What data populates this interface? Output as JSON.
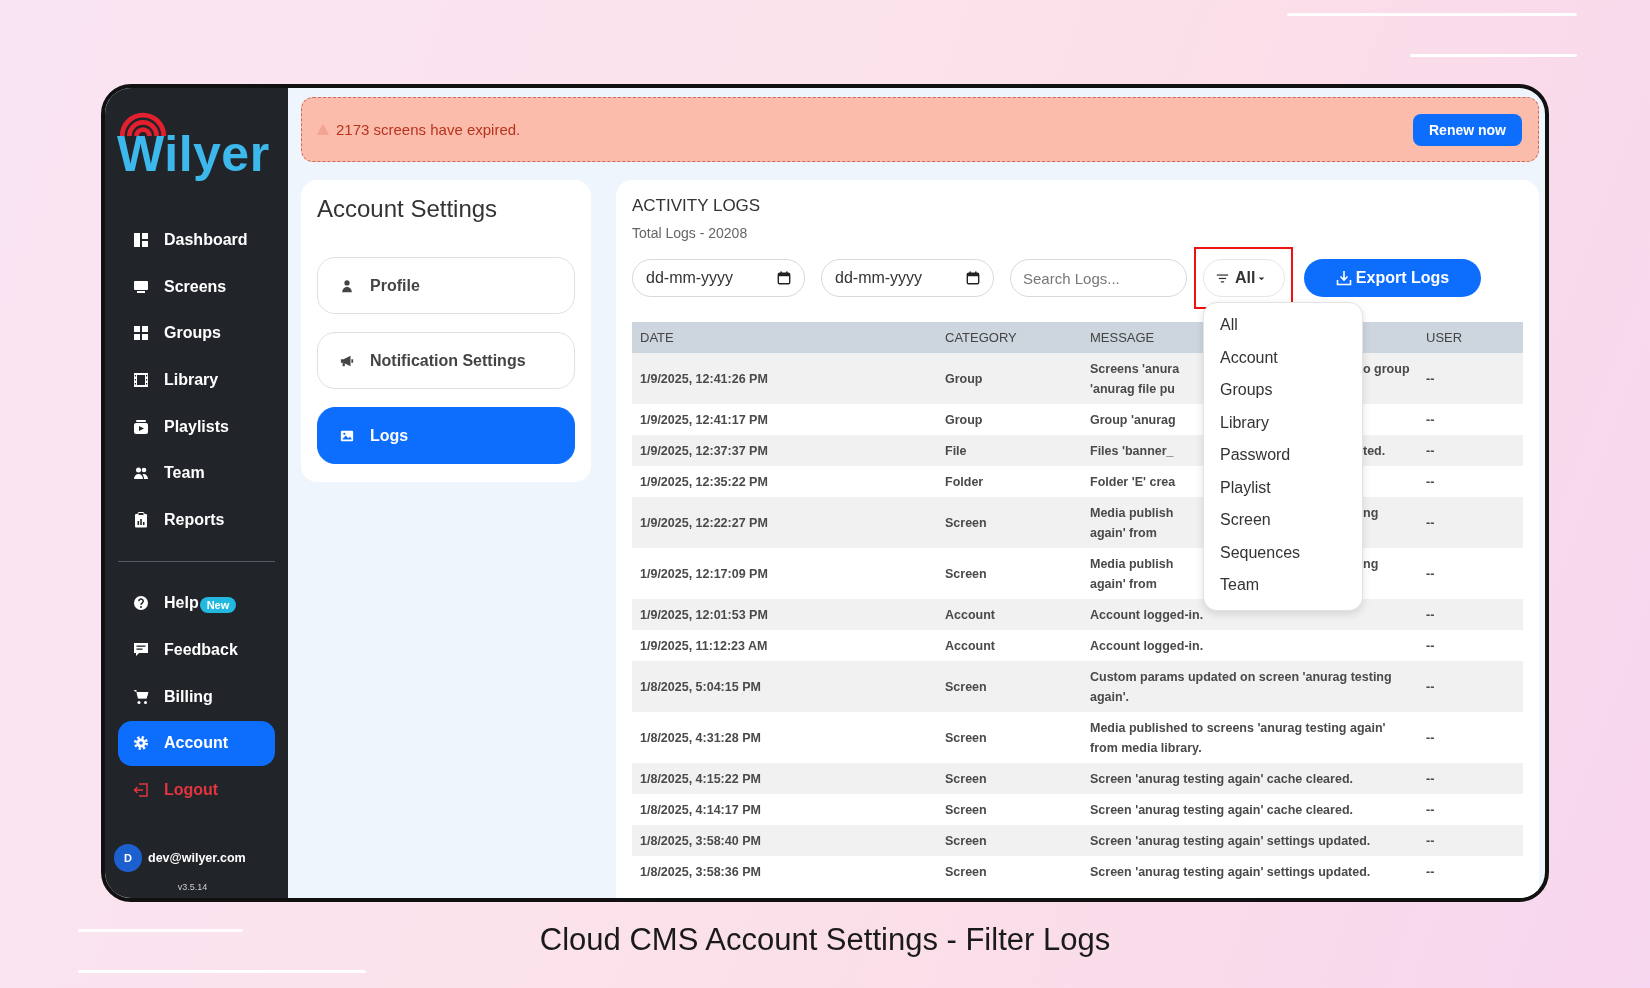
{
  "sidebar": {
    "logo": "Wilyer",
    "main_items": [
      {
        "label": "Dashboard",
        "selected": false,
        "kind": "nav"
      },
      {
        "label": "Screens",
        "selected": false,
        "kind": "nav"
      },
      {
        "label": "Groups",
        "selected": false,
        "kind": "nav"
      },
      {
        "label": "Library",
        "selected": false,
        "kind": "nav"
      },
      {
        "label": "Playlists",
        "selected": false,
        "kind": "nav"
      },
      {
        "label": "Team",
        "selected": false,
        "kind": "nav"
      },
      {
        "label": "Reports",
        "selected": false,
        "kind": "nav"
      }
    ],
    "bottom_items": [
      {
        "label": "Help",
        "selected": false,
        "kind": "nav",
        "badge": "New"
      },
      {
        "label": "Feedback",
        "selected": false,
        "kind": "nav"
      },
      {
        "label": "Billing",
        "selected": false,
        "kind": "nav"
      },
      {
        "label": "Account",
        "selected": true,
        "kind": "nav"
      },
      {
        "label": "Logout",
        "selected": false,
        "kind": "danger"
      }
    ],
    "user": {
      "initial": "D",
      "email": "dev@wilyer.com"
    },
    "version": "v3.5.14"
  },
  "banner": {
    "message": "2173 screens have expired.",
    "button": "Renew now"
  },
  "settings_menu": {
    "title": "Account Settings",
    "items": [
      {
        "label": "Profile",
        "selected": false
      },
      {
        "label": "Notification Settings",
        "selected": false
      },
      {
        "label": "Logs",
        "selected": true
      }
    ]
  },
  "activity_logs": {
    "title": "ACTIVITY LOGS",
    "total": "Total Logs - 20208",
    "from_date": {
      "placeholder": "dd-mm-yyyy"
    },
    "to_date": {
      "placeholder": "dd-mm-yyyy"
    },
    "search": {
      "placeholder": "Search Logs..."
    },
    "filter": {
      "value": "All",
      "highlighted": true
    },
    "export_button": "Export Logs",
    "filter_options": [
      "All",
      "Account",
      "Groups",
      "Library",
      "Password",
      "Playlist",
      "Screen",
      "Sequences",
      "Team"
    ],
    "table": {
      "columns": [
        "DATE",
        "CATEGORY",
        "MESSAGE",
        "USER"
      ],
      "rows": [
        {
          "date": "1/9/2025, 12:41:26 PM",
          "category": "Group",
          "message": [
            {
              "text": "Screens 'anura",
              "after": "o group"
            },
            {
              "text": "'anurag file pu"
            }
          ],
          "user": "--"
        },
        {
          "date": "1/9/2025, 12:41:17 PM",
          "category": "Group",
          "message": [
            {
              "text": "Group 'anurag"
            }
          ],
          "user": "--"
        },
        {
          "date": "1/9/2025, 12:37:37 PM",
          "category": "File",
          "message": [
            {
              "text": "Files 'banner_",
              "after": "ted."
            }
          ],
          "user": "--"
        },
        {
          "date": "1/9/2025, 12:35:22 PM",
          "category": "Folder",
          "message": [
            {
              "text": "Folder 'E' crea"
            }
          ],
          "user": "--"
        },
        {
          "date": "1/9/2025, 12:22:27 PM",
          "category": "Screen",
          "message": [
            {
              "text": "Media publish",
              "after": "ng"
            },
            {
              "text": "again' from"
            }
          ],
          "user": "--"
        },
        {
          "date": "1/9/2025, 12:17:09 PM",
          "category": "Screen",
          "message": [
            {
              "text": "Media publish",
              "after": "ng"
            },
            {
              "text": "again' from"
            }
          ],
          "user": "--"
        },
        {
          "date": "1/9/2025, 12:01:53 PM",
          "category": "Account",
          "message": [
            {
              "text": "Account logged-in."
            }
          ],
          "user": "--"
        },
        {
          "date": "1/9/2025, 11:12:23 AM",
          "category": "Account",
          "message": [
            {
              "text": "Account logged-in."
            }
          ],
          "user": "--"
        },
        {
          "date": "1/8/2025, 5:04:15 PM",
          "category": "Screen",
          "message": [
            {
              "text": "Custom params updated on screen 'anurag testing again'."
            }
          ],
          "user": "--"
        },
        {
          "date": "1/8/2025, 4:31:28 PM",
          "category": "Screen",
          "message": [
            {
              "text": "Media published to screens 'anurag testing again' from media library."
            }
          ],
          "user": "--"
        },
        {
          "date": "1/8/2025, 4:15:22 PM",
          "category": "Screen",
          "message": [
            {
              "text": "Screen 'anurag testing again' cache cleared."
            }
          ],
          "user": "--"
        },
        {
          "date": "1/8/2025, 4:14:17 PM",
          "category": "Screen",
          "message": [
            {
              "text": "Screen 'anurag testing again' cache cleared."
            }
          ],
          "user": "--"
        },
        {
          "date": "1/8/2025, 3:58:40 PM",
          "category": "Screen",
          "message": [
            {
              "text": "Screen 'anurag testing again' settings updated."
            }
          ],
          "user": "--"
        },
        {
          "date": "1/8/2025, 3:58:36 PM",
          "category": "Screen",
          "message": [
            {
              "text": "Screen 'anurag testing again' settings updated."
            }
          ],
          "user": "--"
        }
      ]
    }
  },
  "caption": "Cloud CMS Account Settings - Filter Logs"
}
